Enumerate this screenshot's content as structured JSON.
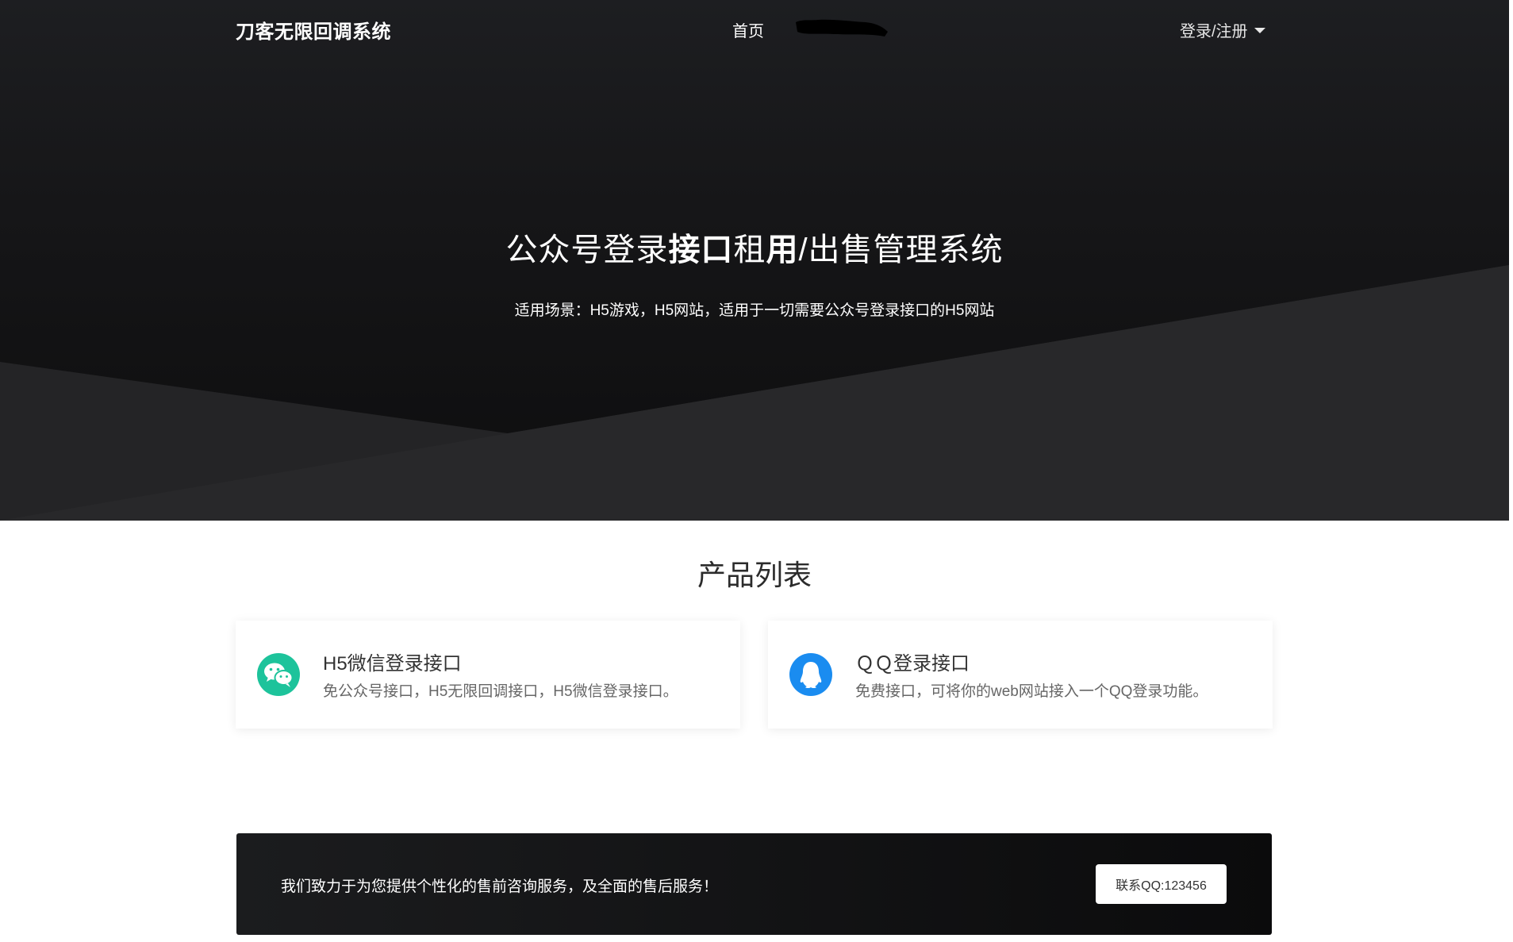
{
  "nav": {
    "brand": "刀客无限回调系统",
    "home": "首页",
    "login": "登录/注册"
  },
  "hero": {
    "title_part1": "公众号登录",
    "title_bold1": "接口",
    "title_part2": "租",
    "title_bold2": "用",
    "title_part3": "/出售管理系统",
    "subtitle": "适用场景：H5游戏，H5网站，适用于一切需要公众号登录接口的H5网站"
  },
  "products": {
    "title": "产品列表",
    "items": [
      {
        "title": "H5微信登录接口",
        "desc": "免公众号接口，H5无限回调接口，H5微信登录接口。",
        "icon": "wechat-icon",
        "color": "#1dc39b"
      },
      {
        "title": "ＱＱ登录接口",
        "desc": "免费接口，可将你的web网站接入一个QQ登录功能。",
        "icon": "qq-icon",
        "color": "#1a8cf0"
      }
    ]
  },
  "contact": {
    "text": "我们致力于为您提供个性化的售前咨询服务，及全面的售后服务！",
    "button": "联系QQ:123456"
  }
}
